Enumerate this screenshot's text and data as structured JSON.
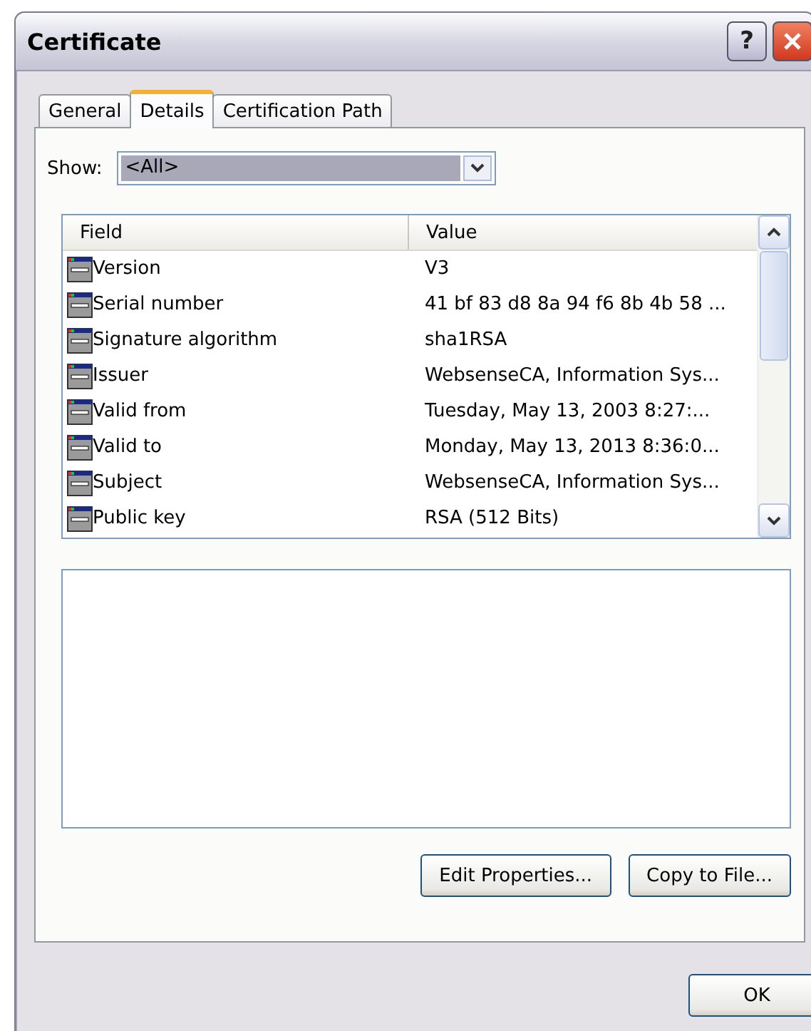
{
  "window": {
    "title": "Certificate",
    "help_button": "?"
  },
  "tabs": [
    {
      "label": "General",
      "selected": false
    },
    {
      "label": "Details",
      "selected": true
    },
    {
      "label": "Certification Path",
      "selected": false
    }
  ],
  "show": {
    "label": "Show:",
    "value": "<All>"
  },
  "table": {
    "columns": [
      "Field",
      "Value"
    ],
    "rows": [
      {
        "field": "Version",
        "value": "V3",
        "selected": false
      },
      {
        "field": "Serial number",
        "value": "41 bf 83 d8 8a 94 f6 8b 4b 58 ...",
        "selected": false
      },
      {
        "field": "Signature algorithm",
        "value": "sha1RSA",
        "selected": false
      },
      {
        "field": "Issuer",
        "value": "WebsenseCA, Information Sys...",
        "selected": false
      },
      {
        "field": "Valid from",
        "value": "Tuesday, May 13, 2003 8:27:...",
        "selected": false
      },
      {
        "field": "Valid to",
        "value": "Monday, May 13, 2013 8:36:0...",
        "selected": false
      },
      {
        "field": "Subject",
        "value": "WebsenseCA, Information Sys...",
        "selected": false
      },
      {
        "field": "Public key",
        "value": "RSA (512 Bits)",
        "selected": false
      }
    ]
  },
  "buttons": [
    "Edit Properties...",
    "Copy to File..."
  ],
  "footer_buttons": [
    "OK"
  ]
}
